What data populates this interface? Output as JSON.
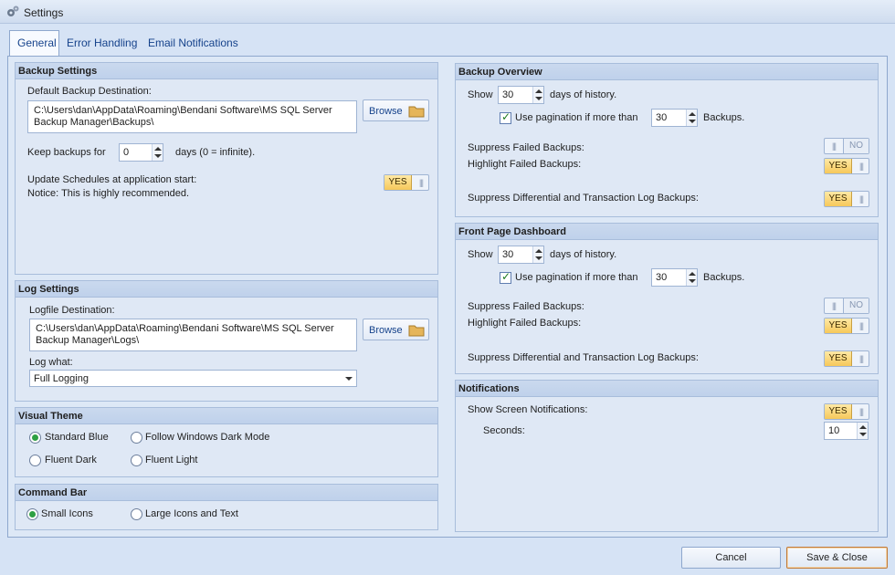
{
  "window": {
    "title": "Settings"
  },
  "tabs": [
    {
      "label": "General"
    },
    {
      "label": "Error Handling"
    },
    {
      "label": "Email Notifications"
    }
  ],
  "backup_settings": {
    "header": "Backup Settings",
    "destination_label": "Default Backup Destination:",
    "destination_value": "C:\\Users\\dan\\AppData\\Roaming\\Bendani Software\\MS SQL Server\nBackup Manager\\Backups\\",
    "browse_label": "Browse",
    "keep_label": "Keep backups for",
    "keep_value": "0",
    "keep_suffix": "days  (0 = infinite).",
    "update_label": "Update Schedules at application start:",
    "update_notice": "Notice: This is highly recommended.",
    "update_toggle": "YES"
  },
  "log_settings": {
    "header": "Log Settings",
    "destination_label": "Logfile Destination:",
    "destination_value": "C:\\Users\\dan\\AppData\\Roaming\\Bendani Software\\MS SQL Server\nBackup Manager\\Logs\\",
    "browse_label": "Browse",
    "log_what_label": "Log what:",
    "log_what_value": "Full Logging"
  },
  "visual_theme": {
    "header": "Visual Theme",
    "options": [
      "Standard Blue",
      "Follow Windows Dark Mode",
      "Fluent Dark",
      "Fluent Light"
    ],
    "selected": "Standard Blue"
  },
  "command_bar": {
    "header": "Command Bar",
    "options": [
      "Small Icons",
      "Large Icons and Text"
    ],
    "selected": "Small Icons"
  },
  "backup_overview": {
    "header": "Backup Overview",
    "show_label": "Show",
    "show_value": "30",
    "show_suffix": "days of history.",
    "pagination_label": "Use pagination if more than",
    "pagination_value": "30",
    "pagination_suffix": "Backups.",
    "suppress_failed_label": "Suppress Failed Backups:",
    "suppress_failed_toggle": "NO",
    "highlight_failed_label": "Highlight Failed Backups:",
    "highlight_failed_toggle": "YES",
    "suppress_diff_label": "Suppress Differential and Transaction Log Backups:",
    "suppress_diff_toggle": "YES"
  },
  "front_page": {
    "header": "Front Page Dashboard",
    "show_label": "Show",
    "show_value": "30",
    "show_suffix": "days of history.",
    "pagination_label": "Use pagination if more than",
    "pagination_value": "30",
    "pagination_suffix": "Backups.",
    "suppress_failed_label": "Suppress Failed Backups:",
    "suppress_failed_toggle": "NO",
    "highlight_failed_label": "Highlight Failed Backups:",
    "highlight_failed_toggle": "YES",
    "suppress_diff_label": "Suppress Differential and Transaction Log Backups:",
    "suppress_diff_toggle": "YES"
  },
  "notifications": {
    "header": "Notifications",
    "show_label": "Show Screen Notifications:",
    "show_toggle": "YES",
    "seconds_label": "Seconds:",
    "seconds_value": "10"
  },
  "footer": {
    "cancel_label": "Cancel",
    "save_label": "Save & Close"
  },
  "toggle_grip": "|||",
  "colors": {
    "accent": "#15428b",
    "toggle_on": "#f6c85a",
    "panel": "#dbe6f4"
  }
}
